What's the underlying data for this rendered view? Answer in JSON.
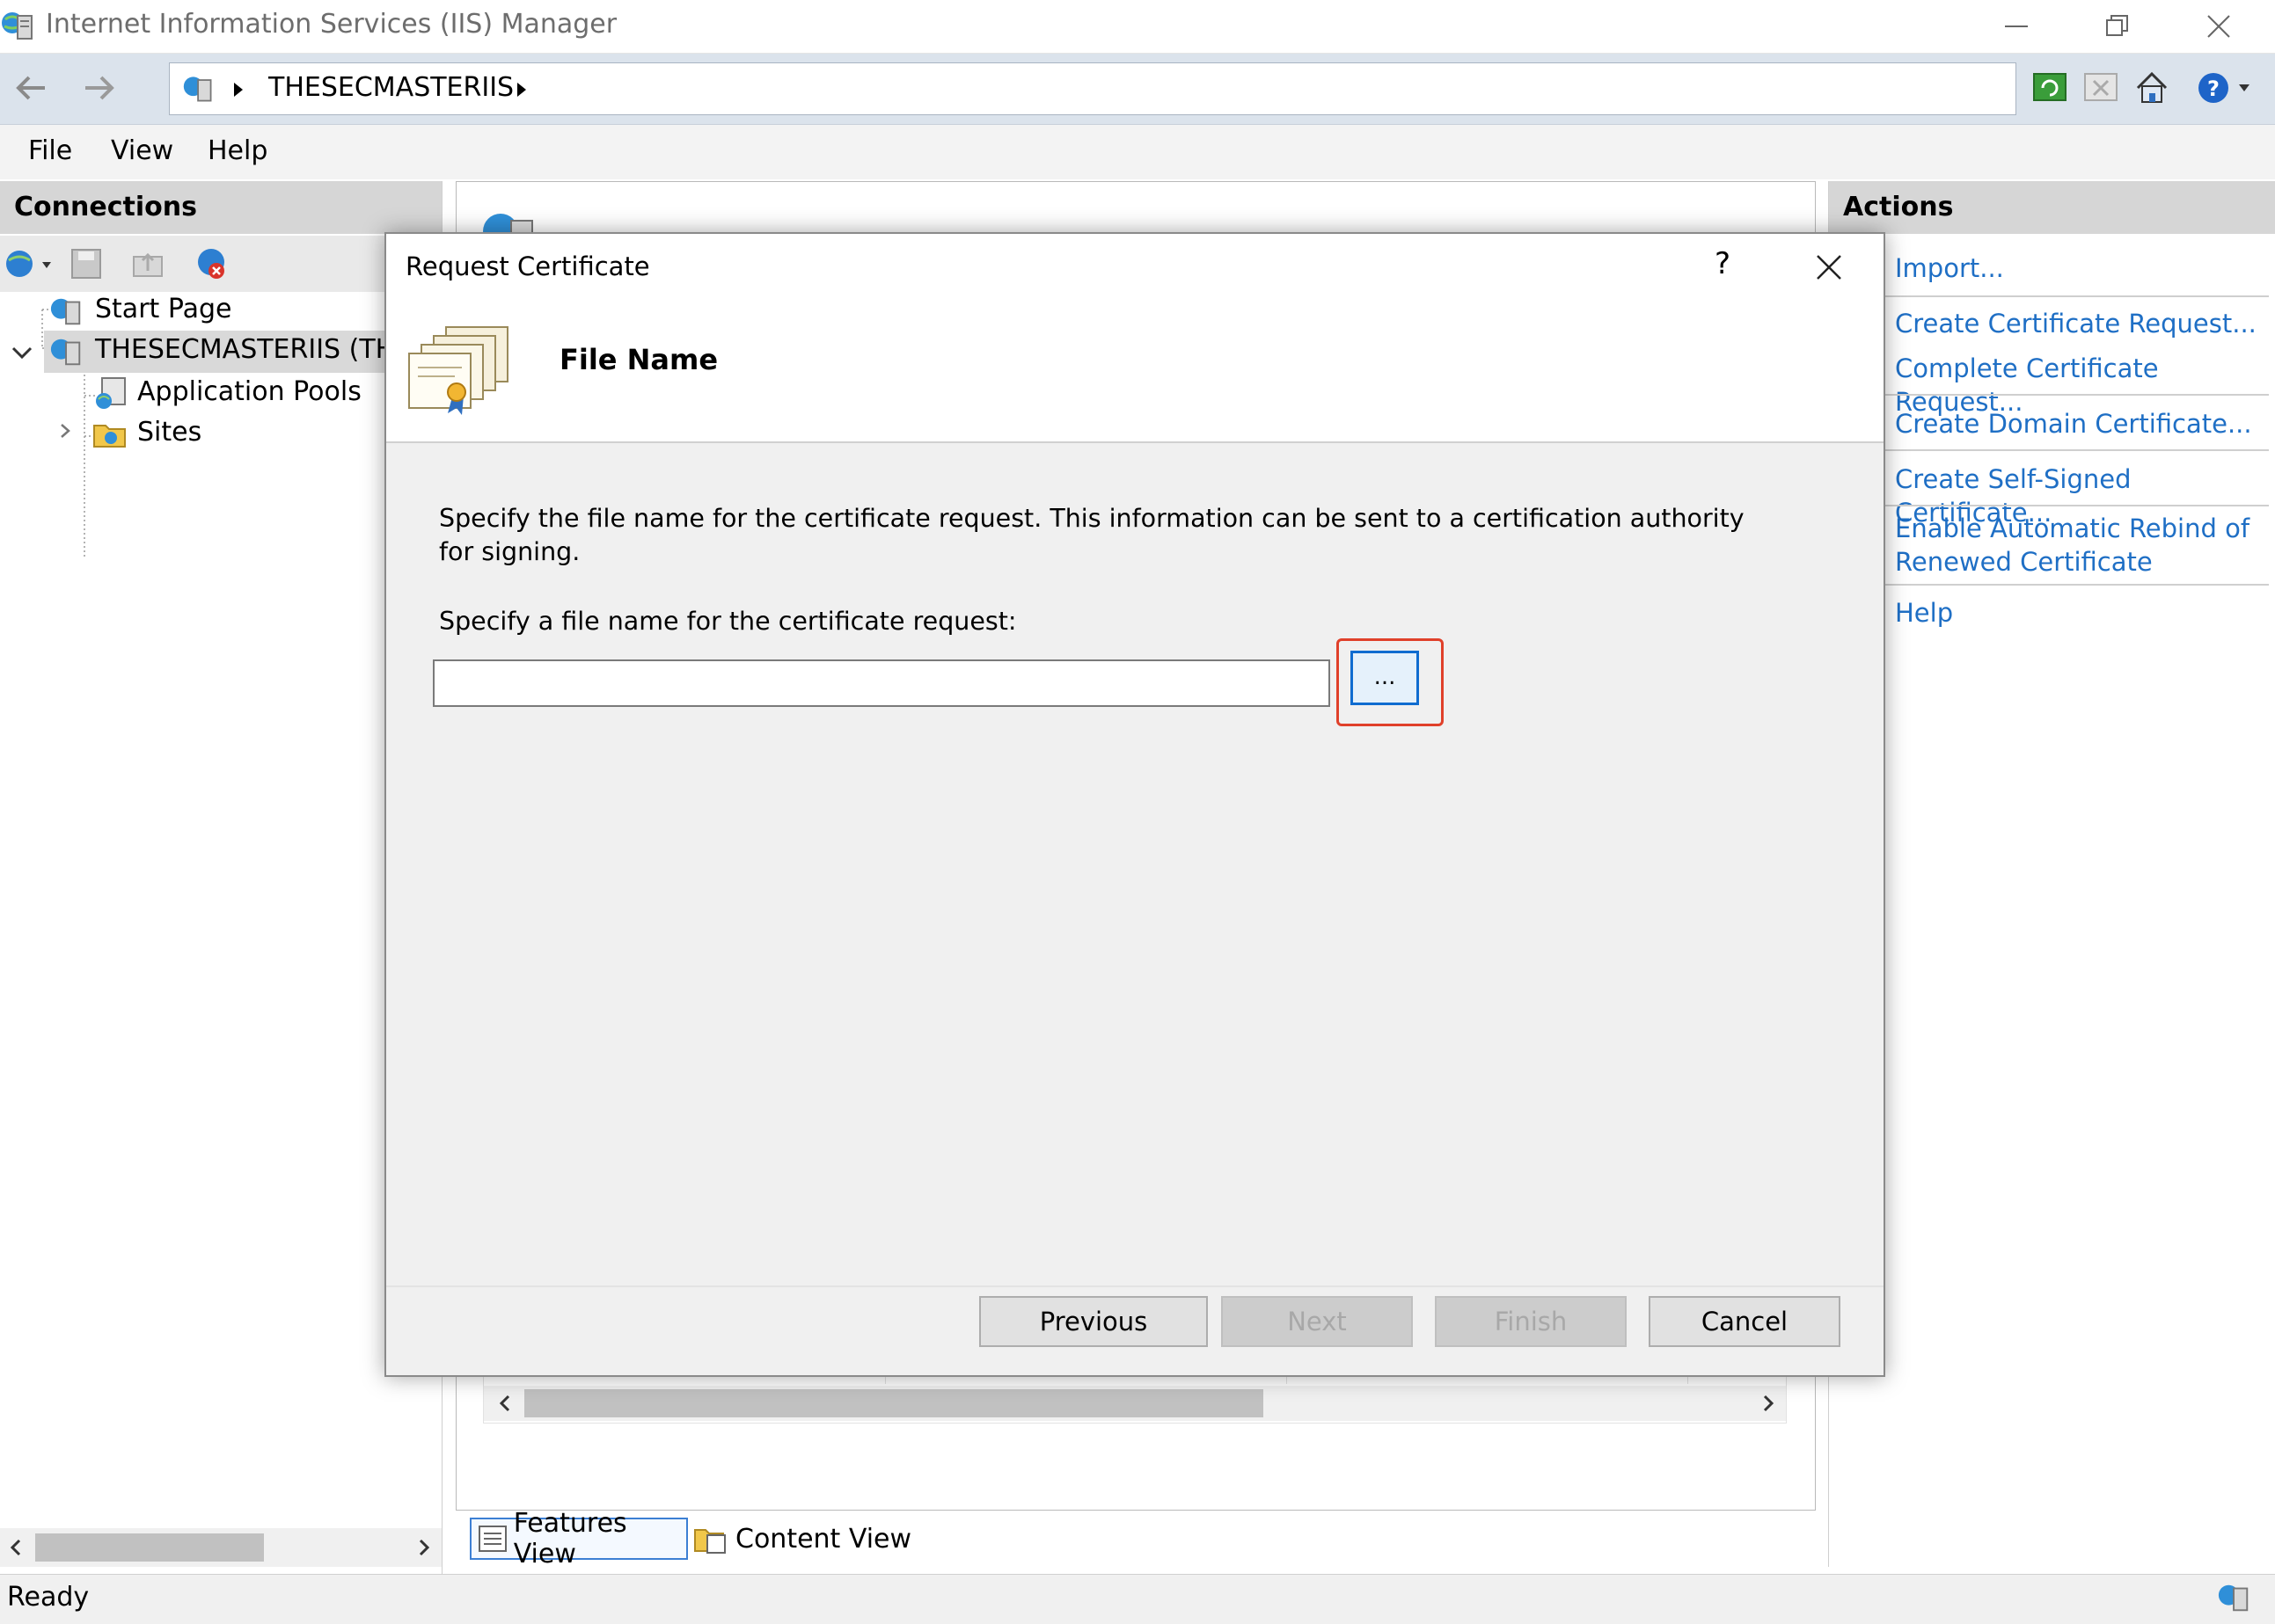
{
  "window": {
    "title": "Internet Information Services (IIS) Manager"
  },
  "address": {
    "crumb": "THESECMASTERIIS"
  },
  "menu": {
    "items": [
      "File",
      "View",
      "Help"
    ]
  },
  "connections": {
    "title": "Connections",
    "tree": [
      {
        "label": "Start Page"
      },
      {
        "label": "THESECMASTERIIS (THES"
      },
      {
        "label": "Application Pools"
      },
      {
        "label": "Sites"
      }
    ]
  },
  "actions": {
    "title": "Actions",
    "links": [
      "Import...",
      "Create Certificate Request...",
      "Complete Certificate Request...",
      "Create Domain Certificate...",
      "Create Self-Signed Certificate...",
      "Enable Automatic Rebind of",
      "Renewed Certificate",
      "Help"
    ]
  },
  "center": {
    "views": {
      "features": "Features View",
      "content": "Content View"
    }
  },
  "dialog": {
    "title": "Request Certificate",
    "help": "?",
    "heading": "File Name",
    "description": "Specify the file name for the certificate request. This information can be sent to a certification authority for signing.",
    "field_label": "Specify a file name for the certificate request:",
    "field_value": "",
    "browse_label": "...",
    "buttons": {
      "previous": "Previous",
      "next": "Next",
      "finish": "Finish",
      "cancel": "Cancel"
    }
  },
  "status": {
    "text": "Ready"
  },
  "colors": {
    "link": "#1f6fc5",
    "highlight": "#e0402a",
    "focus": "#0f6cd0"
  }
}
